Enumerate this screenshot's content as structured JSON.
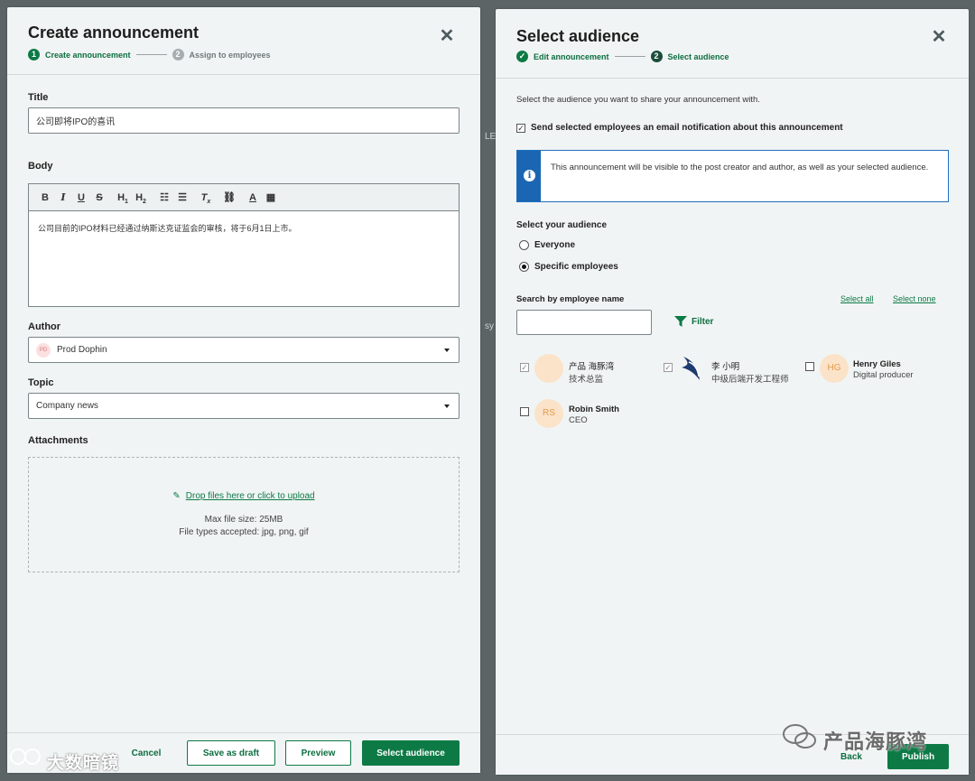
{
  "left": {
    "title": "Create announcement",
    "steps": [
      {
        "num": "1",
        "label": "Create announcement"
      },
      {
        "num": "2",
        "label": "Assign to employees"
      }
    ],
    "title_field": {
      "label": "Title",
      "value": "公司即将IPO的喜讯"
    },
    "body": {
      "label": "Body",
      "toolbar": [
        "B",
        "I",
        "U",
        "S",
        "H1",
        "H2",
        "ordered-list",
        "bullet-list",
        "clear-format",
        "link",
        "font-color",
        "highlight"
      ],
      "content": "公司目前的IPO材料已经通过纳斯达克证监会的审核，将于6月1日上市。"
    },
    "author": {
      "label": "Author",
      "avatar_initials": "PD",
      "value": "Prod Dophin"
    },
    "topic": {
      "label": "Topic",
      "value": "Company news"
    },
    "attachments": {
      "label": "Attachments",
      "link": "Drop files here or click to upload",
      "max_size": "Max file size: 25MB",
      "types": "File types accepted: jpg, png, gif"
    },
    "footer": {
      "cancel": "Cancel",
      "save_draft": "Save as draft",
      "preview": "Preview",
      "select_audience": "Select audience"
    }
  },
  "right": {
    "title": "Select audience",
    "steps": [
      {
        "num": "✓",
        "label": "Edit announcement"
      },
      {
        "num": "2",
        "label": "Select audience"
      }
    ],
    "intro": "Select the audience you want to share your announcement with.",
    "email_notify": {
      "checked": true,
      "label": "Send selected employees an email notification about this announcement"
    },
    "notice": "This announcement will be visible to the post creator and author, as well as your selected audience.",
    "audience": {
      "label": "Select your audience",
      "options": [
        {
          "label": "Everyone",
          "selected": false
        },
        {
          "label": "Specific employees",
          "selected": true
        }
      ]
    },
    "search": {
      "label": "Search by employee name",
      "value": "",
      "select_all": "Select all",
      "select_none": "Select none",
      "filter": "Filter"
    },
    "employees": [
      {
        "name": "产品 海豚湾",
        "role": "技术总监",
        "initials": "",
        "checked": true
      },
      {
        "name": "李 小明",
        "role": "中级后端开发工程师",
        "initials": "",
        "checked": true
      },
      {
        "name": "Henry Giles",
        "role": "Digital producer",
        "initials": "HG",
        "checked": false
      },
      {
        "name": "Robin Smith",
        "role": "CEO",
        "initials": "RS",
        "checked": false
      }
    ],
    "footer": {
      "back": "Back",
      "publish": "Publish"
    }
  },
  "background": {
    "partial_1": "LE",
    "partial_2": "sy"
  },
  "watermarks": {
    "left": "大数暗镜",
    "right": "产品海豚湾"
  },
  "colors": {
    "primary": "#0d7a46",
    "info": "#1a66b3",
    "avatar_bg": "#fbe3c9"
  }
}
